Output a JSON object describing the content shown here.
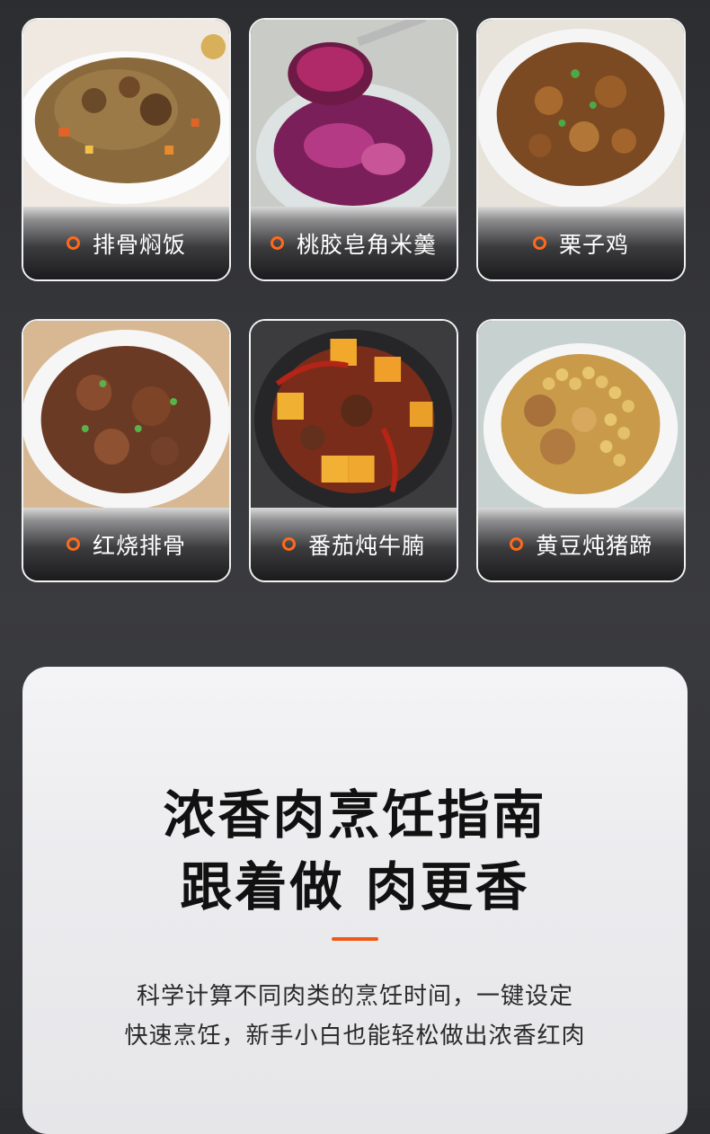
{
  "dishes": [
    {
      "name": "排骨焖饭",
      "image": "braised-rib-rice"
    },
    {
      "name": "桃胶皂角米羹",
      "image": "peach-gum-soup"
    },
    {
      "name": "栗子鸡",
      "image": "chestnut-chicken"
    },
    {
      "name": "红烧排骨",
      "image": "braised-pork-ribs"
    },
    {
      "name": "番茄炖牛腩",
      "image": "tomato-beef-brisket"
    },
    {
      "name": "黄豆炖猪蹄",
      "image": "soybean-pork-trotter"
    }
  ],
  "guide": {
    "title_line1": "浓香肉烹饪指南",
    "title_line2": "跟着做 肉更香",
    "desc_line1": "科学计算不同肉类的烹饪时间，一键设定",
    "desc_line2": "快速烹饪，新手小白也能轻松做出浓香红肉"
  },
  "colors": {
    "accent": "#ee5a16",
    "background": "#35363a",
    "panel": "#ececef"
  }
}
